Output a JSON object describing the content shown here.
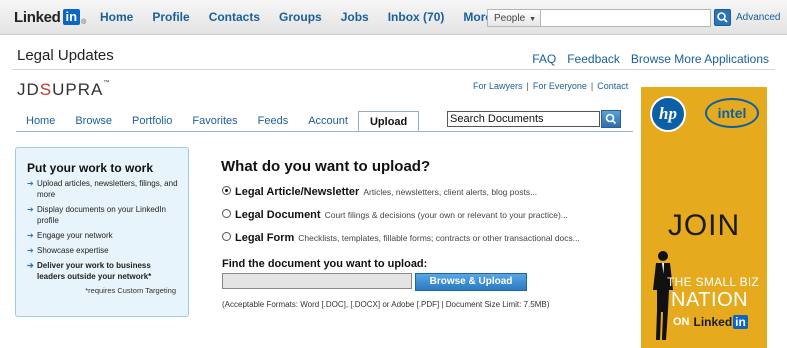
{
  "linkedin": {
    "logo_text": "Linked",
    "logo_in": "in",
    "logo_reg": "®",
    "nav": [
      "Home",
      "Profile",
      "Contacts",
      "Groups",
      "Jobs",
      "Inbox (70)",
      "More..."
    ],
    "search_scope": "People",
    "advanced": "Advanced"
  },
  "app": {
    "title": "Legal Updates",
    "links": [
      "FAQ",
      "Feedback",
      "Browse More Applications"
    ]
  },
  "jdsupra": {
    "logo_a": "JD",
    "logo_s": "S",
    "logo_b": "UPRA",
    "logo_tm": "™",
    "top_links": [
      "For Lawyers",
      "For Everyone",
      "Contact"
    ],
    "tabs": [
      "Home",
      "Browse",
      "Portfolio",
      "Favorites",
      "Feeds",
      "Account",
      "Upload"
    ],
    "active_tab": "Upload",
    "search_value": "Search Documents"
  },
  "promo": {
    "title": "Put your work to work",
    "items": [
      "Upload articles, newsletters, filings, and more",
      "Display documents on your LinkedIn profile",
      "Engage your network",
      "Showcase expertise",
      "Deliver your work to business leaders outside your network*"
    ],
    "note": "*requires Custom Targeting"
  },
  "upload": {
    "question": "What do you want to upload?",
    "options": [
      {
        "label": "Legal Article/Newsletter",
        "desc": "Articles, newsletters, client alerts, blog posts...",
        "selected": true
      },
      {
        "label": "Legal Document",
        "desc": "Court filings & decisions (your own or relevant to your practice)...",
        "selected": false
      },
      {
        "label": "Legal Form",
        "desc": "Checklists, templates, fillable forms; contracts or other transactional docs...",
        "selected": false
      }
    ],
    "find_label": "Find the document you want to upload:",
    "browse_button": "Browse & Upload",
    "formats": "(Acceptable Formats: Word [.DOC], [.DOCX] or Adobe [.PDF] | Document Size Limit: 7.5MB)"
  },
  "ad": {
    "hp": "hp",
    "intel": "intel",
    "join": "JOIN",
    "line1": "THE SMALL BIZ",
    "line2": "NATION",
    "on": "ON",
    "linkedin_text": "Linked",
    "linkedin_in": "in",
    "bg_color": "#e6aa1e"
  }
}
